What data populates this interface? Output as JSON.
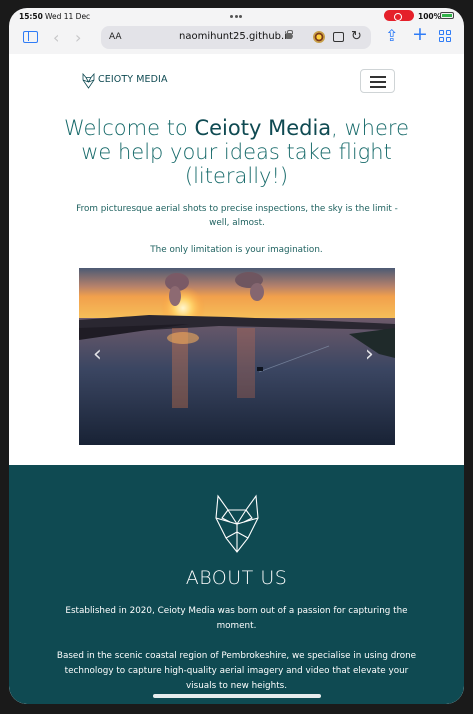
{
  "status_bar": {
    "time": "15:50",
    "date": "Wed 11 Dec",
    "battery": "100%"
  },
  "browser": {
    "text_size_label": "AA",
    "url": "naomihunt25.github.io",
    "icons": [
      "sidebar-icon",
      "back-icon",
      "forward-icon",
      "lock-icon",
      "extension-icon",
      "reader-icon",
      "reload-icon",
      "share-icon",
      "new-tab-icon",
      "tabs-overview-icon"
    ],
    "accent": "#2f7cf6"
  },
  "site": {
    "brand": "CEIOTY MEDIA",
    "hero": {
      "title_pre": "Welcome to ",
      "title_brand": "Ceioty Media",
      "title_post": ", where we help your ideas take flight (literally!)",
      "subtitle": "From picturesque aerial shots to precise inspections, the sky is the limit - well, almost.",
      "limitation": "The only limitation is your imagination."
    },
    "carousel": {
      "prev_symbol": "‹",
      "next_symbol": "›"
    },
    "about": {
      "title": "ABOUT US",
      "paragraph1": "Established in 2020, Ceioty Media was born out of a passion for capturing the moment.",
      "paragraph2": "Based in the scenic coastal region of Pembrokeshire, we specialise in using drone technology to capture high-quality aerial imagery and video that elevate your visuals to new heights."
    },
    "colors": {
      "primary": "#0f4a52",
      "heading": "#176a6a"
    }
  }
}
